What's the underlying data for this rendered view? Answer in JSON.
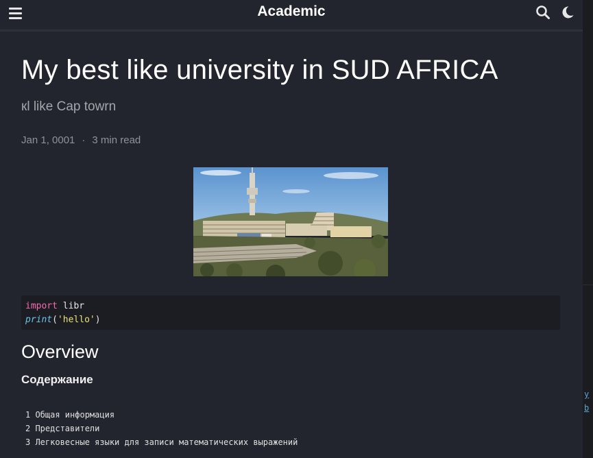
{
  "navbar": {
    "menu_icon": "hamburger-menu-icon",
    "brand": "Academic",
    "search_icon": "search-icon",
    "theme_icon": "moon-icon"
  },
  "article": {
    "title": "My best like university in SUD AFRICA",
    "subtitle": "кl like Cap towrn",
    "date": "Jan 1, 0001",
    "separator": "·",
    "read_time": "3 min read"
  },
  "code": {
    "line1_keyword": "import",
    "line1_rest": " libr",
    "line2_fn": "print",
    "line2_open": "(",
    "line2_string": "'hello'",
    "line2_close": ")"
  },
  "overview": {
    "heading": "Overview",
    "subheading": "Содержание",
    "toc": [
      "1 Общая информация",
      "2 Представители",
      "3 Легковесные языки для записи математических выражений"
    ]
  },
  "gutter": {
    "line1": "y",
    "line2": "b"
  },
  "colors": {
    "background": "#23252e",
    "keyword": "#f56cb0",
    "function": "#6ec4e8",
    "string": "#e8e27a"
  }
}
